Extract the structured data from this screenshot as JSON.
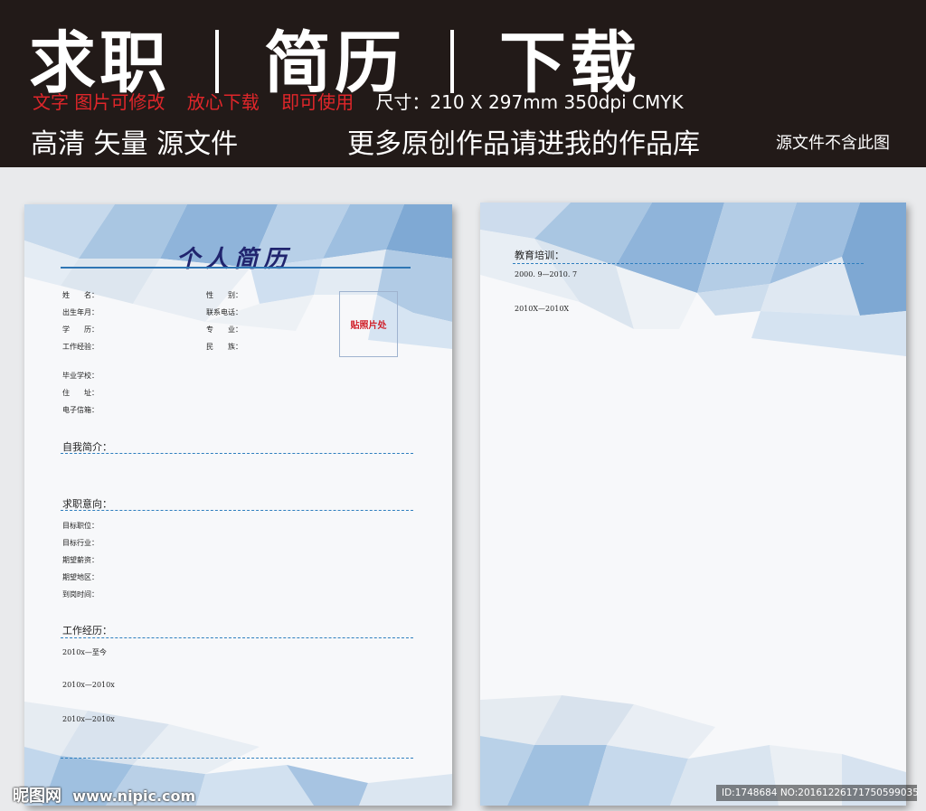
{
  "banner": {
    "title_part1": "求职",
    "title_part2": "简历",
    "title_part3": "下载",
    "row2_red1": "文字 图片可修改",
    "row2_red2": "放心下载",
    "row2_red3": "即可使用",
    "row2_spec": "尺寸：210 X 297mm  350dpi CMYK",
    "row3_left": "高清 矢量 源文件",
    "row3_more": "更多原创作品请进我的作品库",
    "row3_note": "源文件不含此图"
  },
  "left_page": {
    "title": "个人简历",
    "fields_col1": [
      "姓　　名：",
      "出生年月：",
      "学　　历：",
      "工作经验："
    ],
    "fields_col2": [
      "性　　别：",
      "联系电话：",
      "专　　业：",
      "民　　族："
    ],
    "fields_col3": [
      "毕业学校：",
      "住　　址：",
      "电子信箱："
    ],
    "photo_label": "贴照片处",
    "section_intro": "自我简介：",
    "section_job": "求职意向：",
    "job_fields": [
      "目标职位：",
      "目标行业：",
      "期望薪资：",
      "期望地区：",
      "到岗时间："
    ],
    "section_work": "工作经历：",
    "work_entries": [
      "2010x—至今",
      "2010x—2010x",
      "2010x—2010x"
    ]
  },
  "right_page": {
    "section_edu": "教育培训：",
    "edu_entries": [
      "2000. 9—2010. 7",
      "2010X—2010X"
    ]
  },
  "watermark": {
    "site_cn": "昵图网",
    "site_url": "www.nipic.com",
    "id_text": "ID:1748684 NO:20161226171750599035"
  },
  "colors": {
    "banner_bg": "#221a18",
    "accent_red": "#e0262a",
    "title_navy": "#20246e",
    "line_blue": "#2f76b4"
  }
}
